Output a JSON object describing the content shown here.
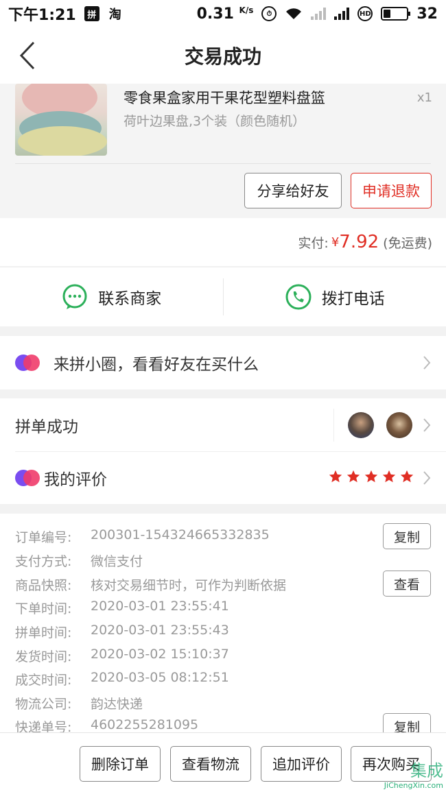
{
  "status_bar": {
    "time": "下午1:21",
    "app1": "拼",
    "app2": "淘",
    "speed": "0.31",
    "speed_unit": "K/s",
    "battery": "32"
  },
  "nav": {
    "title": "交易成功"
  },
  "product": {
    "title": "零食果盒家用干果花型塑料盘篮",
    "subtitle": "荷叶边果盘,3个装（颜色随机）",
    "quantity": "x1",
    "share_button": "分享给好友",
    "refund_button": "申请退款"
  },
  "payment": {
    "label": "实付:",
    "currency": "¥",
    "amount": "7.92",
    "shipping_note": "(免运费)"
  },
  "contact": {
    "merchant": "联系商家",
    "phone": "拨打电话"
  },
  "circle": {
    "label": "来拼小圈，看看好友在买什么"
  },
  "group": {
    "success_label": "拼单成功",
    "review_label": "我的评价",
    "rating": 5
  },
  "order_info": {
    "rows": [
      {
        "label": "订单编号:",
        "value": "200301-154324665332835"
      },
      {
        "label": "支付方式:",
        "value": "微信支付"
      },
      {
        "label": "商品快照:",
        "value": "核对交易细节时，可作为判断依据"
      },
      {
        "label": "下单时间:",
        "value": "2020-03-01 23:55:41"
      },
      {
        "label": "拼单时间:",
        "value": "2020-03-01 23:55:43"
      },
      {
        "label": "发货时间:",
        "value": "2020-03-02 15:10:37"
      },
      {
        "label": "成交时间:",
        "value": "2020-03-05 08:12:51"
      },
      {
        "label": "物流公司:",
        "value": "韵达快递"
      },
      {
        "label": "快递单号:",
        "value": "4602255281095"
      }
    ],
    "copy_button": "复制",
    "view_button": "查看",
    "copy_button_2": "复制"
  },
  "actions": {
    "delete": "删除订单",
    "logistics": "查看物流",
    "add_review": "追加评价",
    "buy_again": "再次购买"
  },
  "watermark": {
    "text": "JiChengXin.com",
    "logo": "集成"
  },
  "colors": {
    "accent": "#e02e24",
    "wechat_green": "#2cb05a",
    "star": "#e02e24"
  }
}
